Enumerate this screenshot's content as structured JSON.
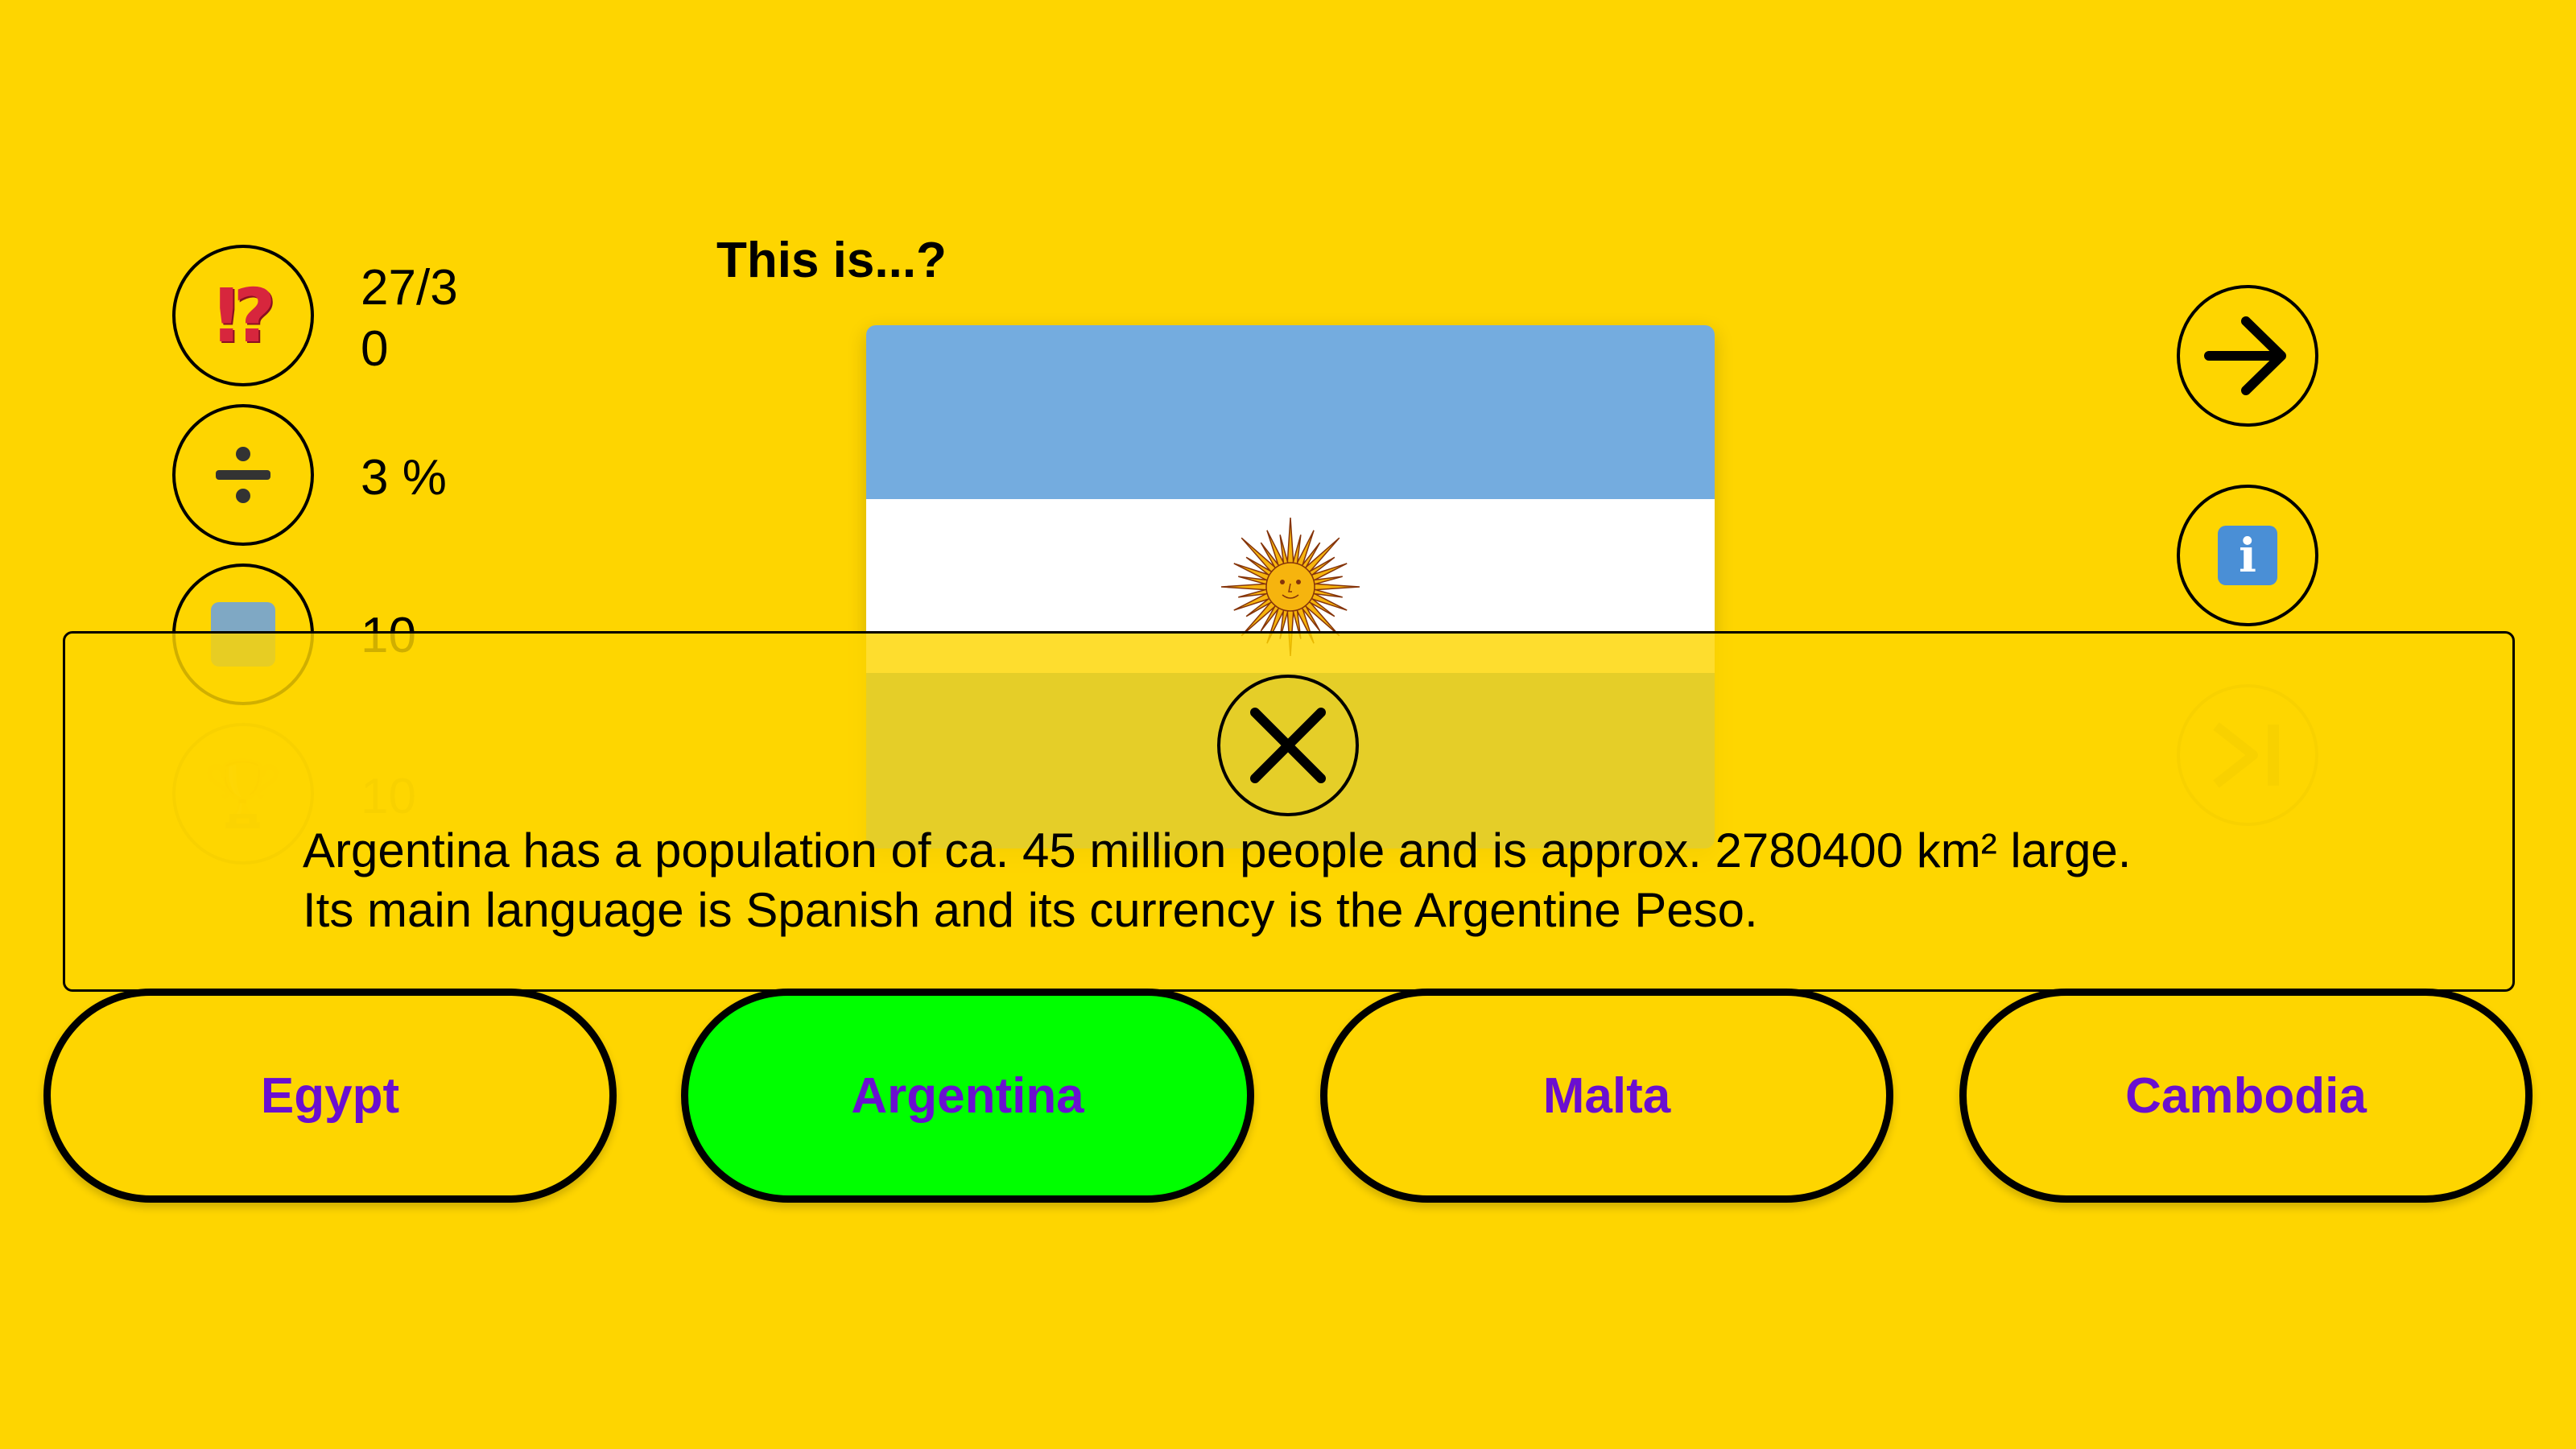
{
  "colors": {
    "background": "#FED500",
    "answer_text": "#6A0FD0",
    "correct_answer_bg": "#00FF00",
    "flag_blue": "#74ACDF",
    "flag_white": "#FFFFFF",
    "sun": "#F6B40E"
  },
  "stats": {
    "questions": {
      "icon": "interrobang-icon",
      "value": "27/3\n0"
    },
    "percent": {
      "icon": "divide-icon",
      "value": "3 %"
    },
    "streak": {
      "icon": "square-icon",
      "value": "10"
    },
    "best": {
      "icon": "trophy-icon",
      "value": "10"
    }
  },
  "question": {
    "title": "This is...?"
  },
  "flag": {
    "country": "Argentina"
  },
  "info_overlay": {
    "close_icon": "close-icon",
    "line1": "Argentina has a population of ca. 45 million people and is approx. 2780400 km² large.",
    "line2": "Its main language is Spanish and its currency is the Argentine Peso."
  },
  "controls": {
    "next_icon": "arrow-right-icon",
    "info_icon": "info-icon",
    "skip_icon": "skip-end-icon"
  },
  "answers": [
    {
      "label": "Egypt",
      "state": "default"
    },
    {
      "label": "Argentina",
      "state": "correct"
    },
    {
      "label": "Malta",
      "state": "default"
    },
    {
      "label": "Cambodia",
      "state": "default"
    }
  ]
}
